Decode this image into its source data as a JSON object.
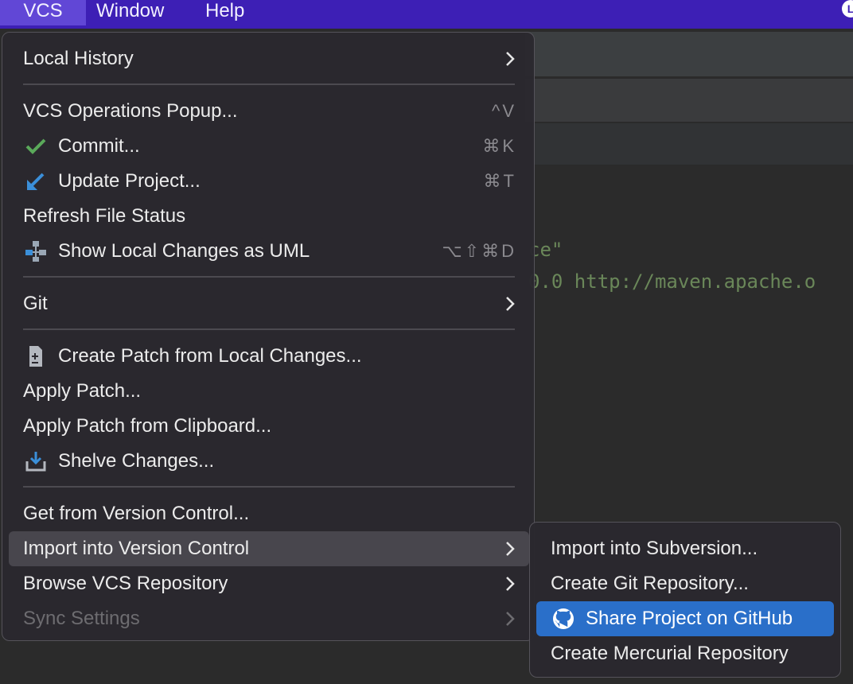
{
  "menubar": {
    "items": [
      "VCS",
      "Window",
      "Help"
    ]
  },
  "editor": {
    "code_lines": [
      "ce\"",
      "0.0 http://maven.apache.o"
    ]
  },
  "vcs_menu": {
    "local_history": "Local History",
    "vcs_operations_popup": {
      "label": "VCS Operations Popup...",
      "shortcut": "^V"
    },
    "commit": {
      "label": "Commit...",
      "shortcut": "⌘K"
    },
    "update_project": {
      "label": "Update Project...",
      "shortcut": "⌘T"
    },
    "refresh_file_status": "Refresh File Status",
    "show_local_changes_uml": {
      "label": "Show Local Changes as UML",
      "shortcut": "⌥⇧⌘D"
    },
    "git": "Git",
    "create_patch": "Create Patch from Local Changes...",
    "apply_patch": "Apply Patch...",
    "apply_patch_clipboard": "Apply Patch from Clipboard...",
    "shelve_changes": "Shelve Changes...",
    "get_from_vcs": "Get from Version Control...",
    "import_into_vcs": "Import into Version Control",
    "browse_vcs_repo": "Browse VCS Repository",
    "sync_settings": "Sync Settings"
  },
  "import_submenu": {
    "import_subversion": "Import into Subversion...",
    "create_git_repo": "Create Git Repository...",
    "share_github": "Share Project on GitHub",
    "create_mercurial": "Create Mercurial Repository"
  },
  "colors": {
    "menubar_bg": "#3d1fb5",
    "menu_bg": "#2a282e",
    "highlight_blue": "#2a6fc9",
    "commit_check_green": "#5aa95a",
    "update_arrow_blue": "#3b8fd9",
    "code_string_green": "#6a8759"
  },
  "icons": [
    "check-icon",
    "update-arrow-icon",
    "uml-diagram-icon",
    "patch-file-icon",
    "shelve-icon",
    "github-icon",
    "chevron-right-icon"
  ]
}
